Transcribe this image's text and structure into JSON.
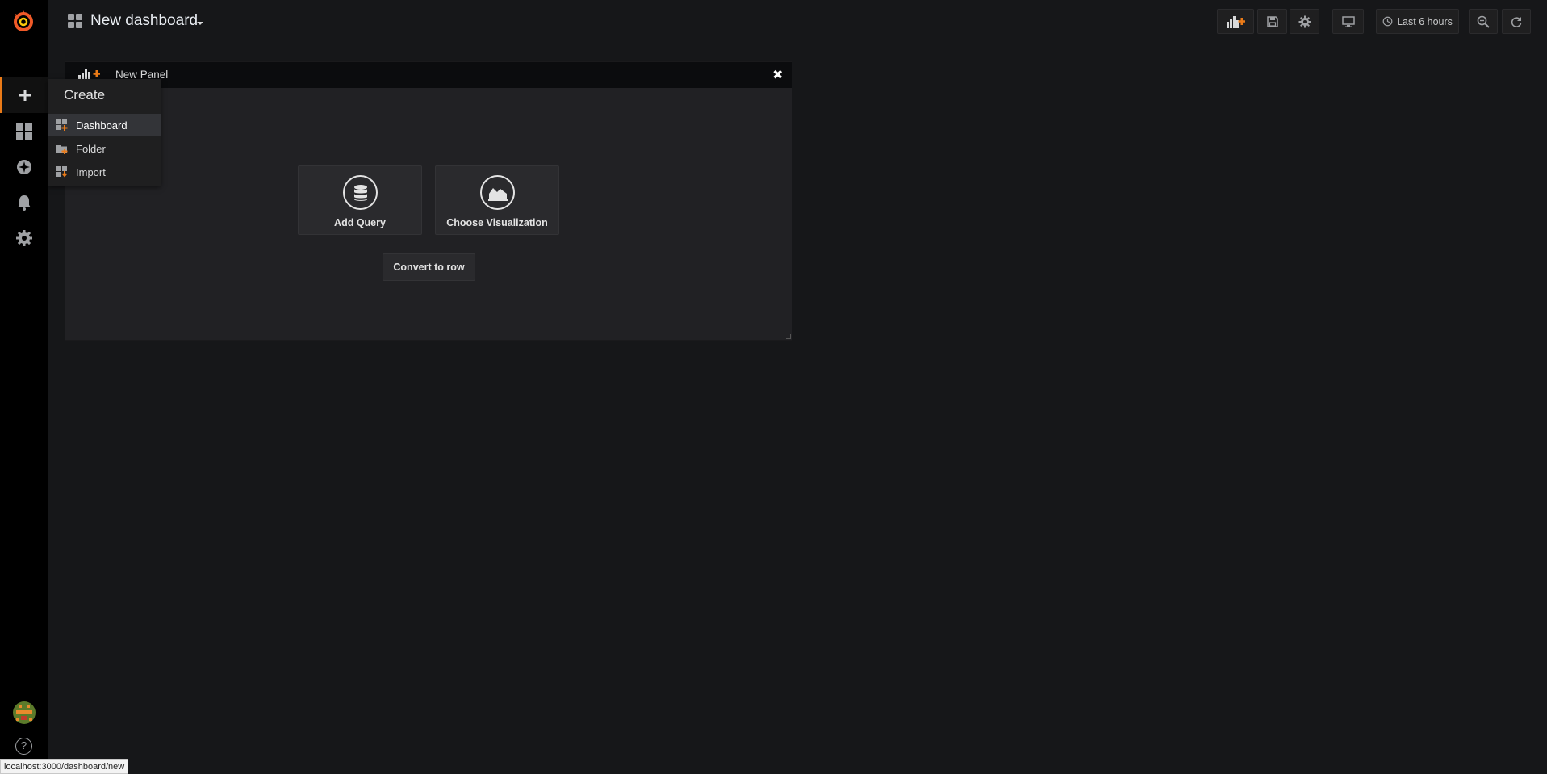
{
  "header": {
    "dashboard_title": "New dashboard",
    "time_range": "Last 6 hours"
  },
  "sidebar": {
    "items": [
      {
        "name": "create",
        "icon": "plus-icon"
      },
      {
        "name": "dashboards",
        "icon": "apps-icon"
      },
      {
        "name": "explore",
        "icon": "compass-icon"
      },
      {
        "name": "alerting",
        "icon": "bell-icon"
      },
      {
        "name": "configuration",
        "icon": "gear-icon"
      }
    ],
    "help_symbol": "?"
  },
  "create_menu": {
    "title": "Create",
    "items": [
      {
        "label": "Dashboard",
        "icon": "dashboard-add-icon"
      },
      {
        "label": "Folder",
        "icon": "folder-add-icon"
      },
      {
        "label": "Import",
        "icon": "import-icon"
      }
    ]
  },
  "panel": {
    "title": "New Panel",
    "close_symbol": "✖",
    "actions": [
      {
        "label": "Add Query",
        "icon": "database-icon"
      },
      {
        "label": "Choose Visualization",
        "icon": "area-chart-icon"
      }
    ],
    "convert_label": "Convert to row"
  },
  "status_url": "localhost:3000/dashboard/new",
  "colors": {
    "accent": "#eb7b18",
    "background": "#161719",
    "sidebar": "#000000",
    "panel": "#212124"
  }
}
